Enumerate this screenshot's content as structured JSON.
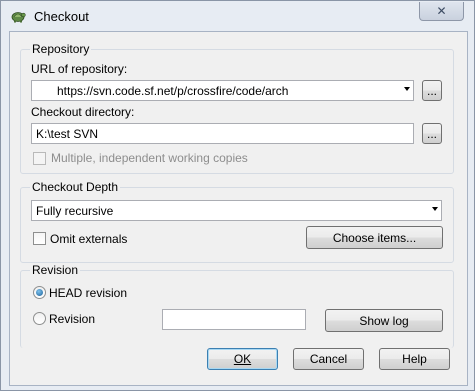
{
  "window": {
    "title": "Checkout",
    "close_label": "✕"
  },
  "repository": {
    "group_label": "Repository",
    "url_label": "URL of repository:",
    "url_value": "https://svn.code.sf.net/p/crossfire/code/arch",
    "browse_label": "...",
    "dir_label": "Checkout directory:",
    "dir_value": "K:\\test SVN",
    "dir_browse_label": "...",
    "multiple_label": "Multiple, independent working copies"
  },
  "depth": {
    "group_label": "Checkout Depth",
    "selected": "Fully recursive",
    "omit_label": "Omit externals",
    "choose_label": "Choose items..."
  },
  "revision": {
    "group_label": "Revision",
    "head_label": "HEAD revision",
    "revision_label": "Revision",
    "revision_value": "",
    "show_log_label": "Show log"
  },
  "buttons": {
    "ok": "OK",
    "cancel": "Cancel",
    "help": "Help"
  },
  "colors": {
    "frame": "#e7ecf3",
    "face": "#f0f0f0",
    "default_border": "#3c7fb1"
  }
}
